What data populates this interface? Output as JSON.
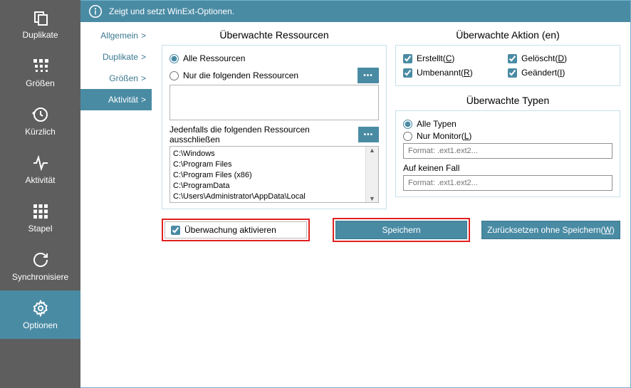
{
  "sidebar": [
    {
      "id": "dup",
      "label": "Duplikate"
    },
    {
      "id": "size",
      "label": "Größen"
    },
    {
      "id": "recent",
      "label": "Kürzlich"
    },
    {
      "id": "activity",
      "label": "Aktivität"
    },
    {
      "id": "stack",
      "label": "Stapel"
    },
    {
      "id": "sync",
      "label": "Synchronisiere"
    },
    {
      "id": "options",
      "label": "Optionen"
    }
  ],
  "header": "Zeigt und setzt WinExt-Optionen.",
  "tabs": [
    {
      "id": "general",
      "label": "Allgemein"
    },
    {
      "id": "dup",
      "label": "Duplikate"
    },
    {
      "id": "size",
      "label": "Größen"
    },
    {
      "id": "activity",
      "label": "Aktivität"
    }
  ],
  "res": {
    "title": "Überwachte Ressourcen",
    "all": "Alle Ressourcen",
    "only": "Nur die folgenden Ressourcen",
    "excl_label": "Jedenfalls die folgenden Ressourcen ausschließen",
    "excl_items": [
      "C:\\Windows",
      "C:\\Program Files",
      "C:\\Program Files (x86)",
      "C:\\ProgramData",
      "C:\\Users\\Administrator\\AppData\\Local"
    ]
  },
  "act": {
    "title": "Überwachte Aktion (en)",
    "created": "Erstellt",
    "created_k": "C",
    "deleted": "Gelöscht",
    "deleted_k": "D",
    "renamed": "Umbenannt",
    "renamed_k": "R",
    "changed": "Geändert",
    "changed_k": "I"
  },
  "typ": {
    "title": "Überwachte Typen",
    "all": "Alle Typen",
    "only": "Nur Monitor",
    "only_k": "L",
    "ph": "Format: .ext1.ext2...",
    "never": "Auf keinen Fall"
  },
  "enable": "Überwachung aktivieren",
  "save": "Speichern",
  "reset": "Zurücksetzen ohne Speichern",
  "reset_k": "W"
}
